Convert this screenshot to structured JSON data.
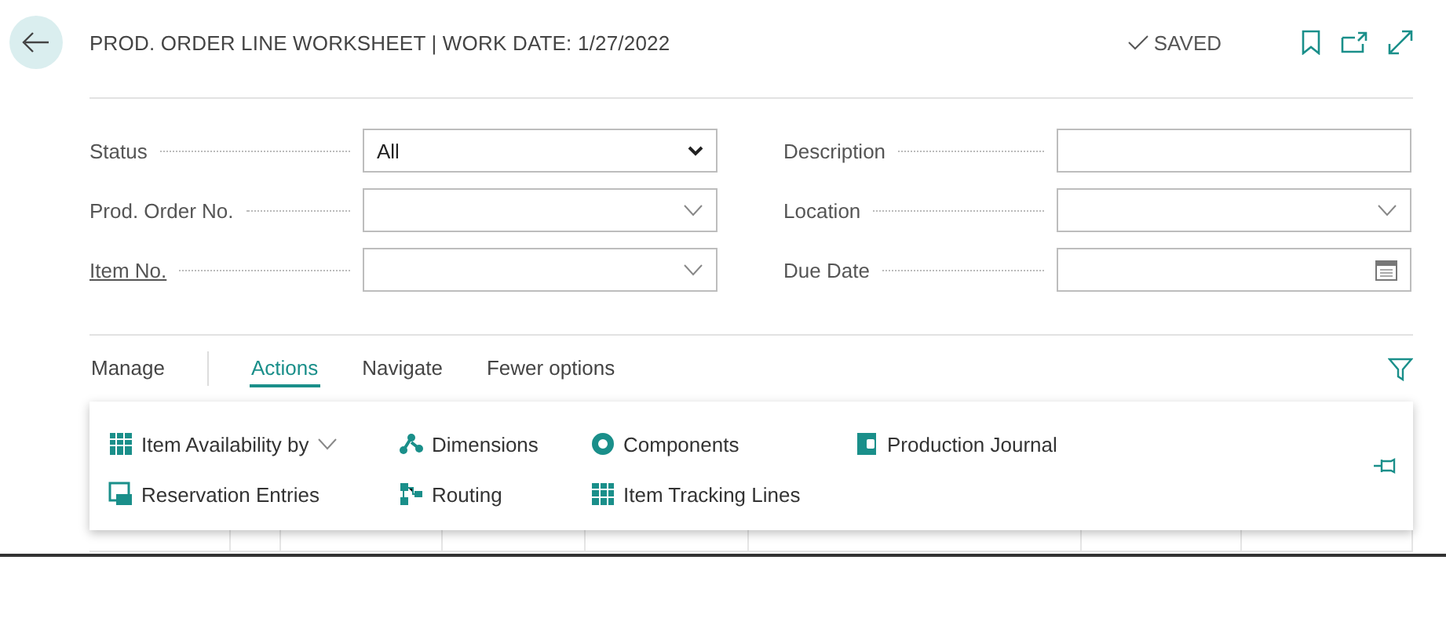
{
  "header": {
    "title": "PROD. ORDER LINE WORKSHEET | WORK DATE: 1/27/2022",
    "status": "SAVED"
  },
  "filters_left": [
    {
      "label": "Status",
      "kind": "select",
      "value": "All",
      "link": false
    },
    {
      "label": "Prod. Order No.",
      "kind": "combo",
      "link": false
    },
    {
      "label": "Item No.",
      "kind": "combo",
      "link": true
    }
  ],
  "filters_right": [
    {
      "label": "Description",
      "kind": "text",
      "link": false
    },
    {
      "label": "Location",
      "kind": "combo",
      "link": false
    },
    {
      "label": "Due Date",
      "kind": "date",
      "link": false
    }
  ],
  "action_tabs": [
    {
      "label": "Manage",
      "selected": false
    },
    {
      "label": "Actions",
      "selected": true
    },
    {
      "label": "Navigate",
      "selected": false
    },
    {
      "label": "Fewer options",
      "selected": false
    }
  ],
  "actions_menu": [
    {
      "label": "Item Availability by",
      "submenu": true
    },
    {
      "label": "Dimensions",
      "submenu": false
    },
    {
      "label": "Components",
      "submenu": false
    },
    {
      "label": "Production Journal",
      "submenu": false
    },
    {
      "label": "Reservation Entries",
      "submenu": false
    },
    {
      "label": "Routing",
      "submenu": false
    },
    {
      "label": "Item Tracking Lines",
      "submenu": false
    }
  ]
}
